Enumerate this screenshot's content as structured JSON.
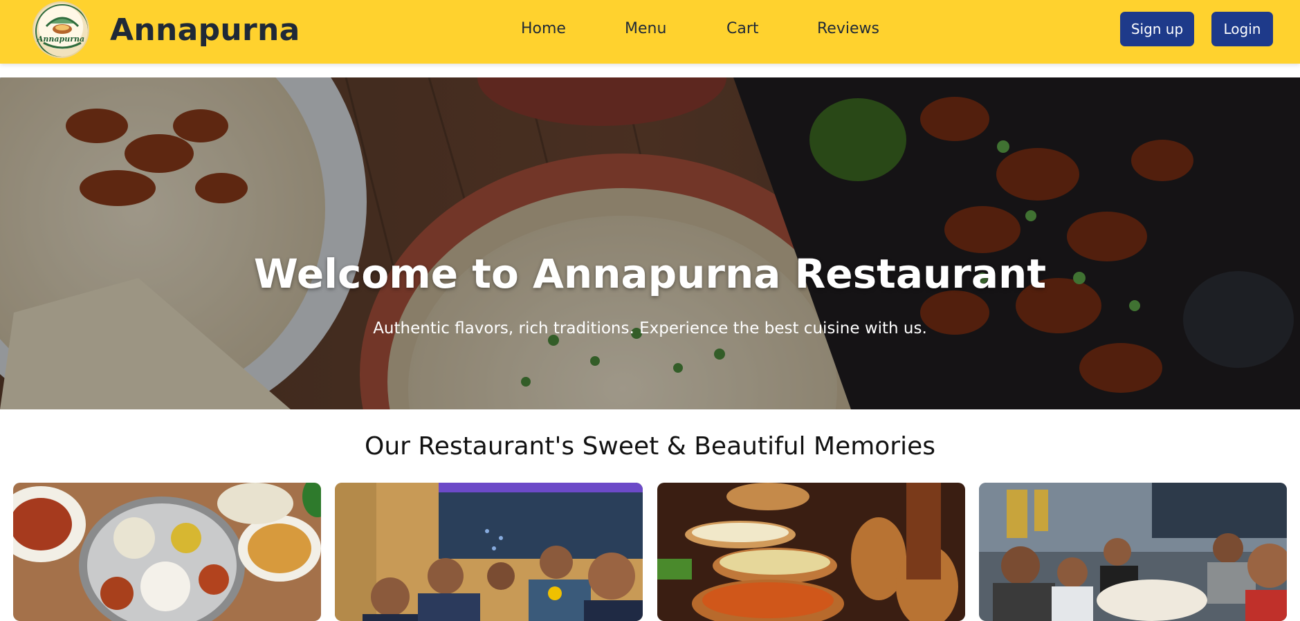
{
  "header": {
    "logo": {
      "icon": "annapurna-logo-emblem",
      "text": "Annapurna"
    },
    "brand": "Annapurna",
    "nav": {
      "home": "Home",
      "menu": "Menu",
      "cart": "Cart",
      "reviews": "Reviews"
    },
    "signup_label": "Sign up",
    "login_label": "Login"
  },
  "hero": {
    "title": "Welcome to Annapurna Restaurant",
    "subtitle": "Authentic flavors, rich traditions. Experience the best cuisine with us."
  },
  "memories": {
    "title": "Our Restaurant's Sweet & Beautiful Memories",
    "photos": [
      {
        "subject": "thali-food-spread"
      },
      {
        "subject": "group-of-diners-thumbs-up"
      },
      {
        "subject": "buffet-copper-pots"
      },
      {
        "subject": "family-dinner-table"
      }
    ]
  },
  "colors": {
    "header_bg": "#ffd22e",
    "button_bg": "#1e3a8a",
    "brand_text": "#1f2937"
  }
}
